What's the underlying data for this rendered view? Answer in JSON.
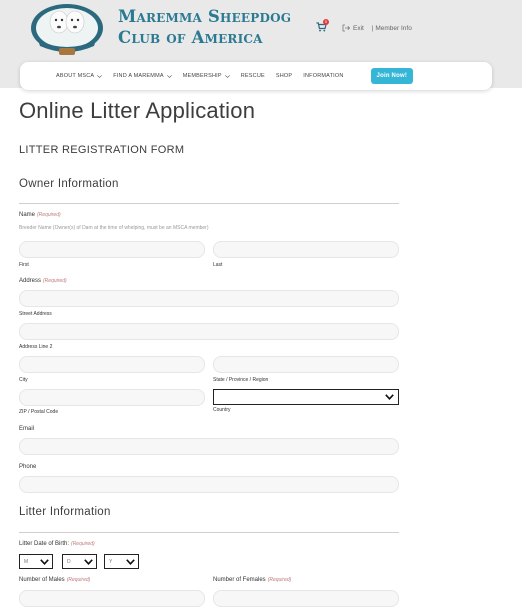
{
  "header": {
    "brand_line1": "Maremma Sheepdog",
    "brand_line2": "Club of America",
    "cart_count": "0",
    "exit_label": "Exit",
    "member_info_label": "| Member Info",
    "logo_text_top": "Maremma Sheepdog",
    "logo_text_bottom": "Club of America",
    "logo_badge": "MSCA"
  },
  "nav": {
    "items": [
      {
        "label": "ABOUT MSCA",
        "dropdown": true
      },
      {
        "label": "FIND A MAREMMA",
        "dropdown": true
      },
      {
        "label": "MEMBERSHIP",
        "dropdown": true
      },
      {
        "label": "RESCUE",
        "dropdown": false
      },
      {
        "label": "SHOP",
        "dropdown": false
      },
      {
        "label": "INFORMATION",
        "dropdown": false
      }
    ],
    "join_label": "Join Now!"
  },
  "page": {
    "title": "Online Litter Application",
    "form_title": "LITTER REGISTRATION FORM"
  },
  "owner": {
    "section_title": "Owner Information",
    "name_label": "Name",
    "required_text": "(Required)",
    "name_hint": "Breeder Name (Owner(s) of Dam at the time of whelping, must be an MSCA member)",
    "first_label": "First",
    "last_label": "Last",
    "address_label": "Address",
    "street_label": "Street Address",
    "line2_label": "Address Line 2",
    "city_label": "City",
    "state_label": "State / Province / Region",
    "zip_label": "ZIP / Postal Code",
    "country_label": "Country",
    "email_label": "Email",
    "phone_label": "Phone"
  },
  "litter": {
    "section_title": "Litter Information",
    "dob_label": "Litter Date of Birth:",
    "month_placeholder": "M",
    "day_placeholder": "D",
    "year_placeholder": "Y",
    "males_label": "Number of Males",
    "females_label": "Number of Females"
  },
  "colors": {
    "brand": "#2b7a91",
    "join": "#36b6d6",
    "header_bg": "#e9e9e9",
    "required": "#c07b7b"
  }
}
